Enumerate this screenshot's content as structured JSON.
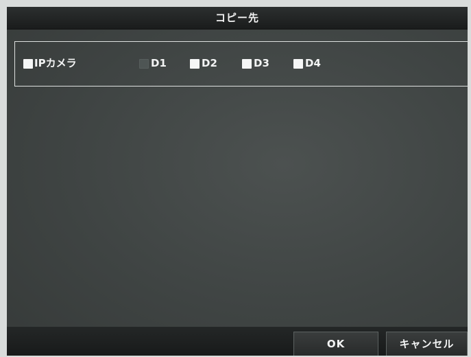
{
  "dialog": {
    "title": "コピー先"
  },
  "channels": {
    "ip_camera_label": "IPカメラ",
    "items": [
      {
        "label": "D1",
        "enabled": false,
        "checked": false
      },
      {
        "label": "D2",
        "enabled": true,
        "checked": false
      },
      {
        "label": "D3",
        "enabled": true,
        "checked": false
      },
      {
        "label": "D4",
        "enabled": true,
        "checked": false
      }
    ]
  },
  "buttons": {
    "ok": "OK",
    "cancel": "キャンセル"
  },
  "colors": {
    "panel": "#434847",
    "title_bar": "#222424",
    "text": "#f3f4f4"
  }
}
